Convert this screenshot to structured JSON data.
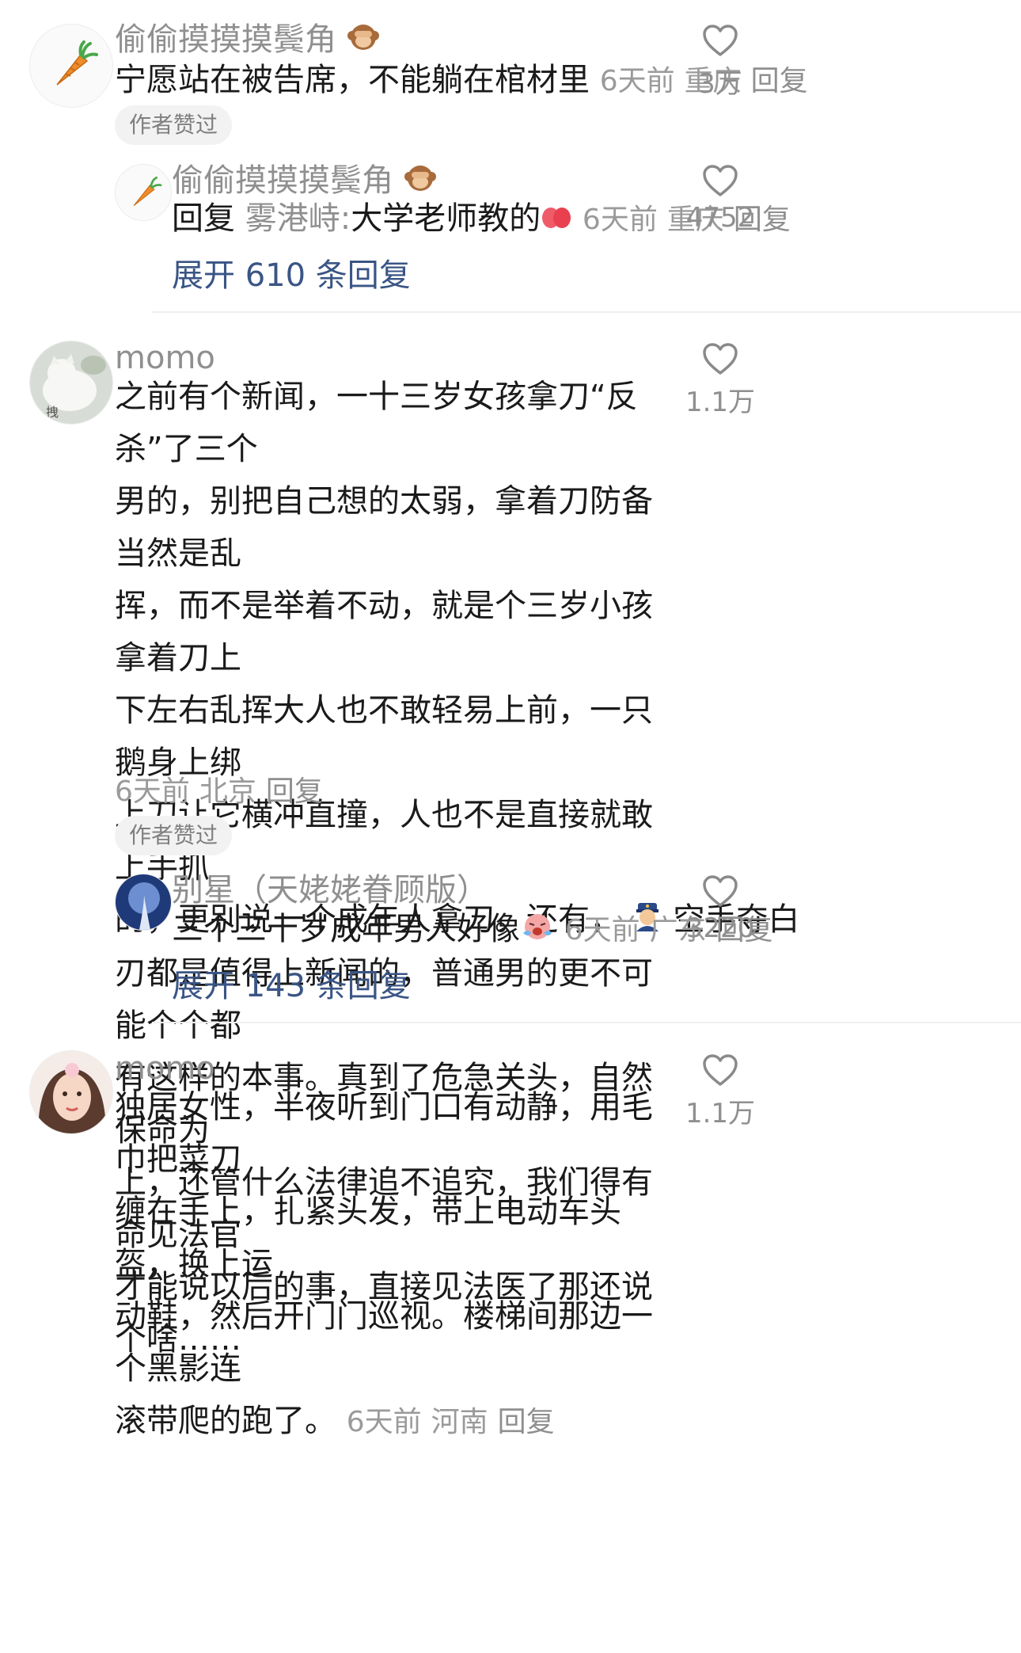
{
  "comments": [
    {
      "username": "偷偷摸摸摸鬓角",
      "text": "宁愿站在被告席，不能躺在棺材里",
      "time": "6天前",
      "location": "重庆",
      "reply_label": "回复",
      "likes": "3万",
      "badge": "作者赞过",
      "avatar_icon": "carrot-avatar",
      "sub_reply": {
        "username": "偷偷摸摸摸鬓角",
        "reply_prefix": "回复",
        "reply_to": "雾港峙:",
        "text": "大学老师教的",
        "time": "6天前",
        "location": "重庆",
        "reply_label": "回复",
        "likes": "4752"
      },
      "expand_label": "展开 610 条回复"
    },
    {
      "username": "momo",
      "lines": [
        "之前有个新闻，一十三岁女孩拿刀“反杀”了三个",
        "男的，别把自己想的太弱，拿着刀防备当然是乱",
        "挥，而不是举着不动，就是个三岁小孩拿着刀上",
        "下左右乱挥大人也不敢轻易上前，一只鹅身上绑",
        "上刀让它横冲直撞，人也不是直接就敢上手抓",
        "的，更别说一个成年人拿刀。还有，",
        "空手夺白",
        "刃都是值得上新闻的，普通男的更不可能个个都",
        "有这样的本事。真到了危急关头，自然保命为",
        "上，还管什么法律追不追究，我们得有命见法官",
        "才能说以后的事，直接见法医了那还说个啥……"
      ],
      "time": "6天前",
      "location": "北京",
      "reply_label": "回复",
      "likes": "1.1万",
      "badge": "作者赞过",
      "avatar_caption": "拽",
      "sub_reply": {
        "username": "别星（天姥姥眷顾版）",
        "text": "三个三十岁成年男人好像",
        "time": "6天前",
        "location": "广东",
        "reply_label": "回复",
        "likes": "3220"
      },
      "expand_label": "展开 143 条回复"
    },
    {
      "username": "momo",
      "lines": [
        "独居女性，半夜听到门口有动静，用毛巾把菜刀",
        "缠在手上，扎紧头发，带上电动车头盔，换上运",
        "动鞋，然后开门门巡视。楼梯间那边一个黑影连",
        "滚带爬的跑了。"
      ],
      "time": "6天前",
      "location": "河南",
      "reply_label": "回复",
      "likes": "1.1万"
    }
  ],
  "colors": {
    "text": "#1a1a1a",
    "meta": "#9a9a9a",
    "link": "#3a5585",
    "badge_bg": "#f2f2f2",
    "divider": "#efefef"
  },
  "icons": [
    "heart-outline-icon",
    "carrot-icon",
    "monkey-emoji",
    "peach-emoji",
    "police-officer-emoji",
    "crying-face-emoji"
  ]
}
